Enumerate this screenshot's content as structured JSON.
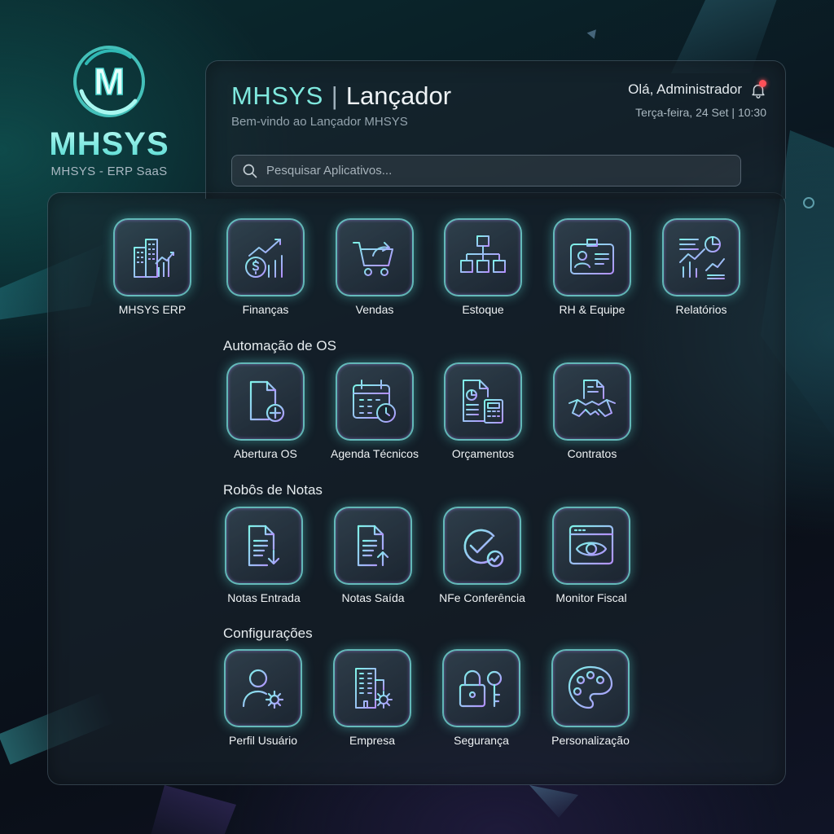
{
  "logo": {
    "mark": "M",
    "name": "MHSYS",
    "subtitle": "MHSYS - ERP SaaS"
  },
  "header": {
    "brand": "MHSYS",
    "separator": "|",
    "title": "Lançador",
    "welcome": "Bem-vindo ao Lançador MHSYS",
    "greeting": "Olá, Administrador",
    "datetime": "Terça-feira, 24 Set | 10:30",
    "notification_badge": "0"
  },
  "search": {
    "placeholder": "Pesquisar Aplicativos..."
  },
  "apps_main": [
    {
      "label": "MHSYS ERP",
      "icon": "building-chart-icon"
    },
    {
      "label": "Finanças",
      "icon": "coin-growth-icon"
    },
    {
      "label": "Vendas",
      "icon": "shopping-cart-icon"
    },
    {
      "label": "Estoque",
      "icon": "inventory-tree-icon"
    },
    {
      "label": "RH & Equipe",
      "icon": "id-badge-icon"
    },
    {
      "label": "Relatórios",
      "icon": "report-chart-icon"
    }
  ],
  "sections": [
    {
      "title": "Automação de OS",
      "apps": [
        {
          "label": "Abertura OS",
          "icon": "document-add-icon"
        },
        {
          "label": "Agenda Técnicos",
          "icon": "calendar-clock-icon"
        },
        {
          "label": "Orçamentos",
          "icon": "document-calculator-icon"
        },
        {
          "label": "Contratos",
          "icon": "handshake-document-icon"
        }
      ]
    },
    {
      "title": "Robôs de Notas",
      "apps": [
        {
          "label": "Notas Entrada",
          "icon": "document-download-icon"
        },
        {
          "label": "Notas Saída",
          "icon": "document-upload-icon"
        },
        {
          "label": "NFe Conferência",
          "icon": "check-circle-icon"
        },
        {
          "label": "Monitor Fiscal",
          "icon": "eye-window-icon"
        }
      ]
    },
    {
      "title": "Configurações",
      "apps": [
        {
          "label": "Perfil Usuário",
          "icon": "user-settings-icon"
        },
        {
          "label": "Empresa",
          "icon": "company-settings-icon"
        },
        {
          "label": "Segurança",
          "icon": "lock-key-icon"
        },
        {
          "label": "Personalização",
          "icon": "palette-icon"
        }
      ]
    }
  ],
  "colors": {
    "accent_cyan": "#5fe0d8",
    "accent_violet": "#b08cff",
    "badge_red": "#ff5058"
  }
}
